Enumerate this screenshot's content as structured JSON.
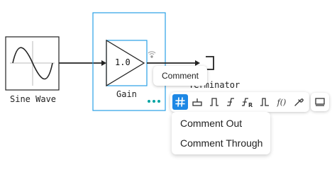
{
  "blocks": {
    "sine_wave": {
      "label": "Sine Wave"
    },
    "gain": {
      "label": "Gain",
      "value": "1.0"
    },
    "terminator": {
      "label": "Terminator"
    }
  },
  "tooltip": {
    "text": "Comment"
  },
  "toolbar": {
    "items": [
      {
        "icon": "comment-hash-icon",
        "active": true
      },
      {
        "icon": "port-down-icon"
      },
      {
        "icon": "pulse-icon"
      },
      {
        "icon": "step-rising-icon"
      },
      {
        "icon": "step-rising-r-icon"
      },
      {
        "icon": "pulse-wave-icon"
      },
      {
        "icon": "function-icon",
        "label": "f()"
      },
      {
        "icon": "eyedropper-icon"
      }
    ],
    "extra_icon": "display-icon"
  },
  "menu": {
    "items": [
      {
        "label": "Comment Out"
      },
      {
        "label": "Comment Through"
      }
    ]
  },
  "colors": {
    "selection": "#29a0e6",
    "active": "#1e88e5",
    "menu_dots": "#00a3a3"
  }
}
